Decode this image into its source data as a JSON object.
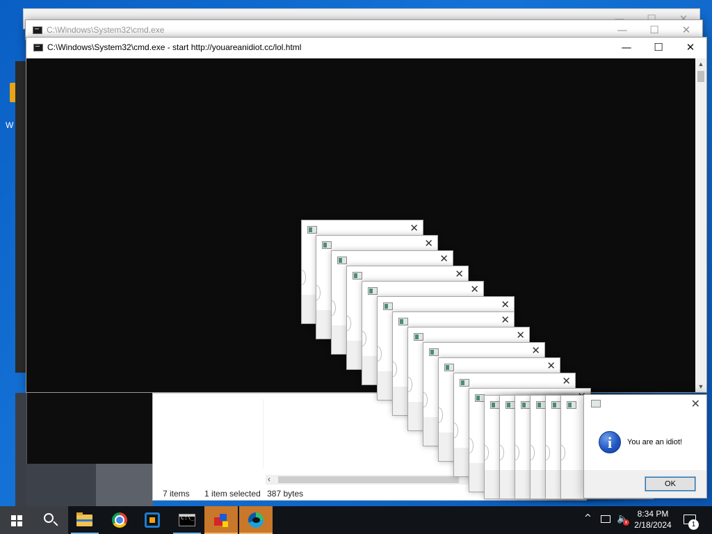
{
  "desktop": {
    "icon_label_fragment": "W"
  },
  "windows": {
    "back": {
      "title": ""
    },
    "cmd_background": {
      "title": "C:\\Windows\\System32\\cmd.exe"
    },
    "cmd_foreground": {
      "title": "C:\\Windows\\System32\\cmd.exe - start  http://youareanidiot.cc/lol.html"
    }
  },
  "caption_buttons": {
    "minimize": "—",
    "maximize": "☐",
    "close": "✕"
  },
  "explorer": {
    "status": {
      "items": "7 items",
      "selected": "1 item selected",
      "size": "387 bytes"
    }
  },
  "popups": {
    "count": 19,
    "close_glyph": "✕"
  },
  "message_box": {
    "text": "You are an idiot!",
    "ok_label": "OK",
    "icon": "information-icon",
    "close_glyph": "✕"
  },
  "taskbar": {
    "items": [
      {
        "name": "start-button",
        "icon": "windows-logo-icon"
      },
      {
        "name": "search-button",
        "icon": "search-icon"
      },
      {
        "name": "file-explorer",
        "icon": "folder-icon",
        "state": "open"
      },
      {
        "name": "chrome",
        "icon": "chrome-icon"
      },
      {
        "name": "virtualbox",
        "icon": "virtualbox-icon"
      },
      {
        "name": "command-prompt",
        "icon": "cmd-icon",
        "state": "open"
      },
      {
        "name": "youareanidiot-app",
        "icon": "shapes-icon",
        "state": "flashing"
      },
      {
        "name": "edge",
        "icon": "edge-icon",
        "state": "flashing"
      }
    ],
    "cmd_icon_text": "C:\\_",
    "tray": {
      "chevron": "^",
      "volume_glyph": "🔈",
      "volume_muted_badge": "x",
      "time": "8:34 PM",
      "date": "2/18/2024",
      "notification_count": "1"
    },
    "colors": {
      "background": "#101317",
      "flash": "#c9772a",
      "accent": "#76b9ed"
    }
  }
}
